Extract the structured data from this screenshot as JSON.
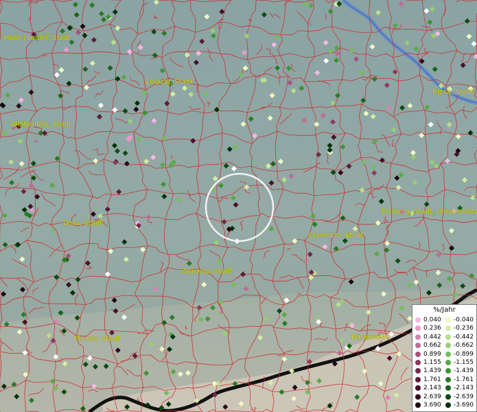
{
  "cities": [
    {
      "id": "halle",
      "name": "Halle (Saale), Stadt"
    },
    {
      "id": "leipzig",
      "name": "Leipzig, Stadt"
    },
    {
      "id": "riesa",
      "name": "Riesa, Stadt"
    },
    {
      "id": "weissenfels",
      "name": "Weißenfels, Stadt"
    },
    {
      "id": "gera",
      "name": "Gera, Stadt"
    },
    {
      "id": "freiberg",
      "name": "Freiberg, Stadt, Universitätsstadt"
    },
    {
      "id": "chemnitz",
      "name": "Chemnitz, Stadt"
    },
    {
      "id": "zwickau",
      "name": "Zwickau, Stadt"
    },
    {
      "id": "plauen",
      "name": "Plauen, Stadt"
    },
    {
      "id": "barenstein",
      "name": "Bärenstein"
    }
  ],
  "legend": {
    "title": "%/Jahr",
    "positive": [
      {
        "label": "0.040",
        "color": "#f4b8e6"
      },
      {
        "label": "0.236",
        "color": "#e89ccc"
      },
      {
        "label": "0.442",
        "color": "#d684b4"
      },
      {
        "label": "0.662",
        "color": "#c06a98"
      },
      {
        "label": "0.899",
        "color": "#a8507c"
      },
      {
        "label": "1.155",
        "color": "#8e3a62"
      },
      {
        "label": "1.439",
        "color": "#74284c"
      },
      {
        "label": "1.761",
        "color": "#5c1a38"
      },
      {
        "label": "2.143",
        "color": "#461028"
      },
      {
        "label": "2.639",
        "color": "#30081a"
      },
      {
        "label": "3.690",
        "color": "#1c0410"
      }
    ],
    "negative": [
      {
        "label": "-0.040",
        "color": "#f0f8c4"
      },
      {
        "label": "-0.236",
        "color": "#d6eca6"
      },
      {
        "label": "-0.442",
        "color": "#b8de8c"
      },
      {
        "label": "-0.662",
        "color": "#98ce74"
      },
      {
        "label": "-0.899",
        "color": "#78bc5e"
      },
      {
        "label": "-1.155",
        "color": "#5aa848"
      },
      {
        "label": "-1.439",
        "color": "#409236"
      },
      {
        "label": "-1.761",
        "color": "#2c7a28"
      },
      {
        "label": "-2.143",
        "color": "#1c621c"
      },
      {
        "label": "-2.639",
        "color": "#104a12"
      },
      {
        "label": "-3.690",
        "color": "#06320a"
      }
    ]
  }
}
